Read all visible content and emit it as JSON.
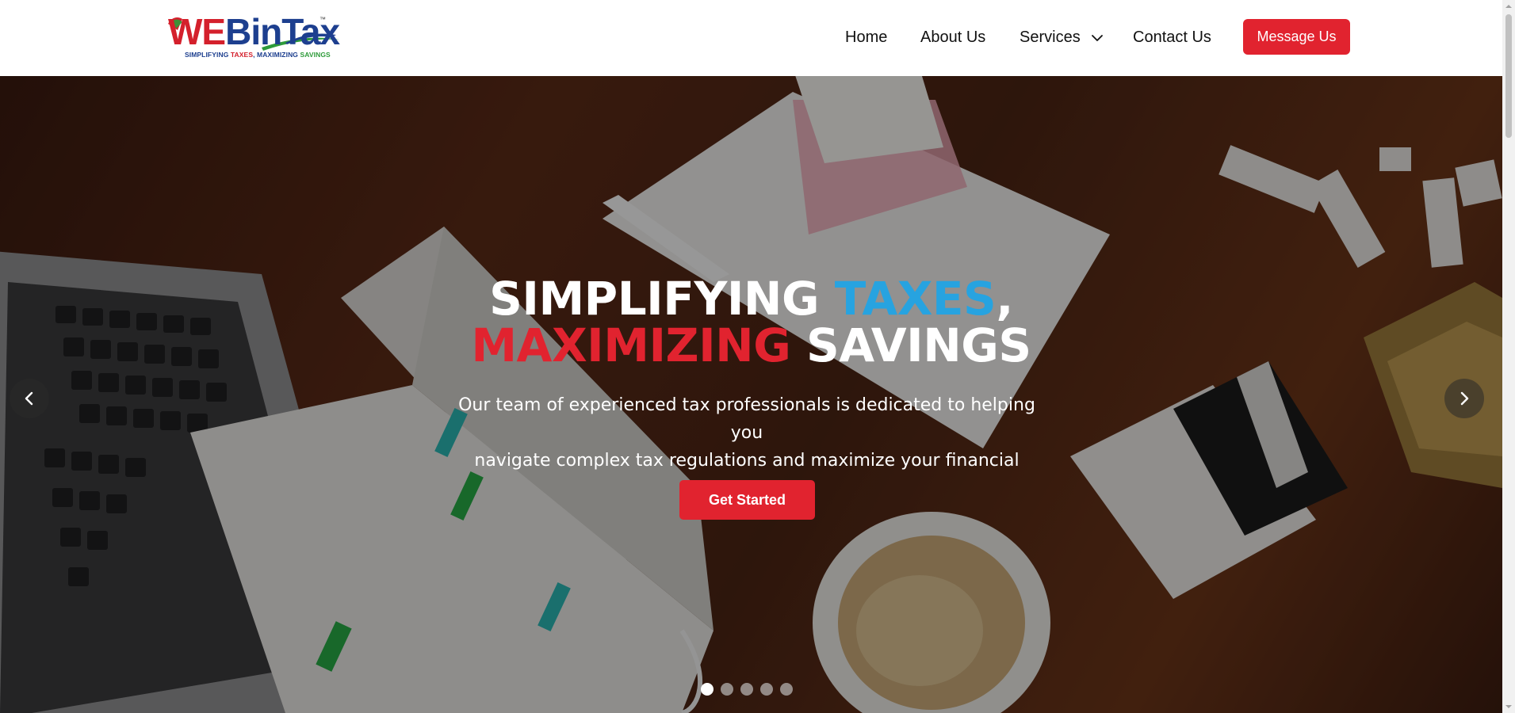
{
  "brand": {
    "logo_text_red": "WE",
    "logo_text_blue": "BinTax",
    "tm": "™",
    "tagline_1": "SIMPLIFYING ",
    "tagline_2": "TAXES",
    "tagline_3": ", MAXIMIZING ",
    "tagline_4": "SAVINGS"
  },
  "nav": {
    "items": [
      {
        "label": "Home"
      },
      {
        "label": "About Us"
      },
      {
        "label": "Services"
      },
      {
        "label": "Contact Us"
      }
    ],
    "cta_label": "Message Us"
  },
  "hero": {
    "title_part1": "SIMPLIFYING ",
    "title_part2": "TAXES",
    "title_part3": ",",
    "title_part4": "MAXIMIZING",
    "title_part5": " SAVINGS",
    "description_line1": "Our team of experienced tax professionals is dedicated to helping you",
    "description_line2": "navigate complex tax regulations and maximize your financial potential.",
    "cta_label": "Get Started",
    "slides_total": 5,
    "active_slide": 1
  },
  "colors": {
    "accent_red": "#e1232f",
    "accent_blue": "#27a3e0",
    "logo_blue": "#1d3f8f",
    "logo_green": "#2e9b3a"
  },
  "icons": {
    "services_dropdown": "chevron-down-icon",
    "prev": "chevron-left-icon",
    "next": "chevron-right-icon"
  }
}
